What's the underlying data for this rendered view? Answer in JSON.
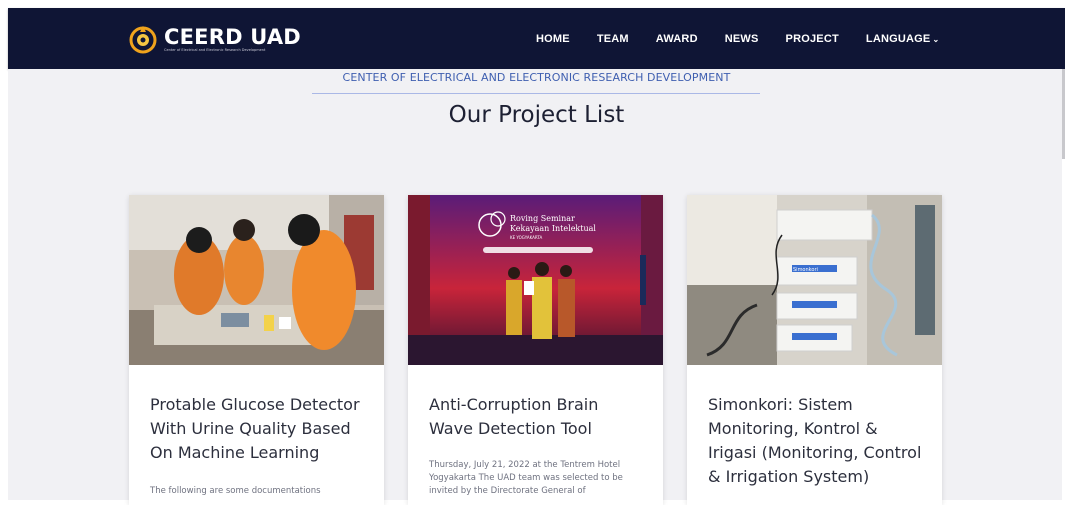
{
  "brand": {
    "name": "CEERD UAD",
    "tagline": "Center of Electrical and Electronic Research Development"
  },
  "nav": {
    "items": [
      "HOME",
      "TEAM",
      "AWARD",
      "NEWS",
      "PROJECT"
    ],
    "language_label": "LANGUAGE"
  },
  "section": {
    "kicker": "CENTER OF ELECTRICAL AND ELECTRONIC RESEARCH DEVELOPMENT",
    "title": "Our Project List"
  },
  "projects": [
    {
      "title": "Protable Glucose Detector With Urine Quality Based On Machine Learning",
      "excerpt": "The following are some documentations"
    },
    {
      "title": "Anti-Corruption Brain Wave Detection Tool",
      "excerpt": "Thursday, July 21, 2022 at the Tentrem Hotel Yogyakarta The UAD team was selected to be invited by the Directorate General of"
    },
    {
      "title": "Simonkori: Sistem Monitoring, Kontrol & Irigasi (Monitoring, Control & Irrigation System)",
      "excerpt": ""
    }
  ],
  "banner": {
    "line1": "Roving Seminar",
    "line2": "Kekayaan Intelektual",
    "line3": "KE YOGYAKARTA"
  },
  "device_label": "Simonkori",
  "colors": {
    "navbar": "#0f1535",
    "accent_orange": "#f0a31c",
    "kicker_blue": "#3f5fb0",
    "page_bg": "#f1f1f4"
  }
}
